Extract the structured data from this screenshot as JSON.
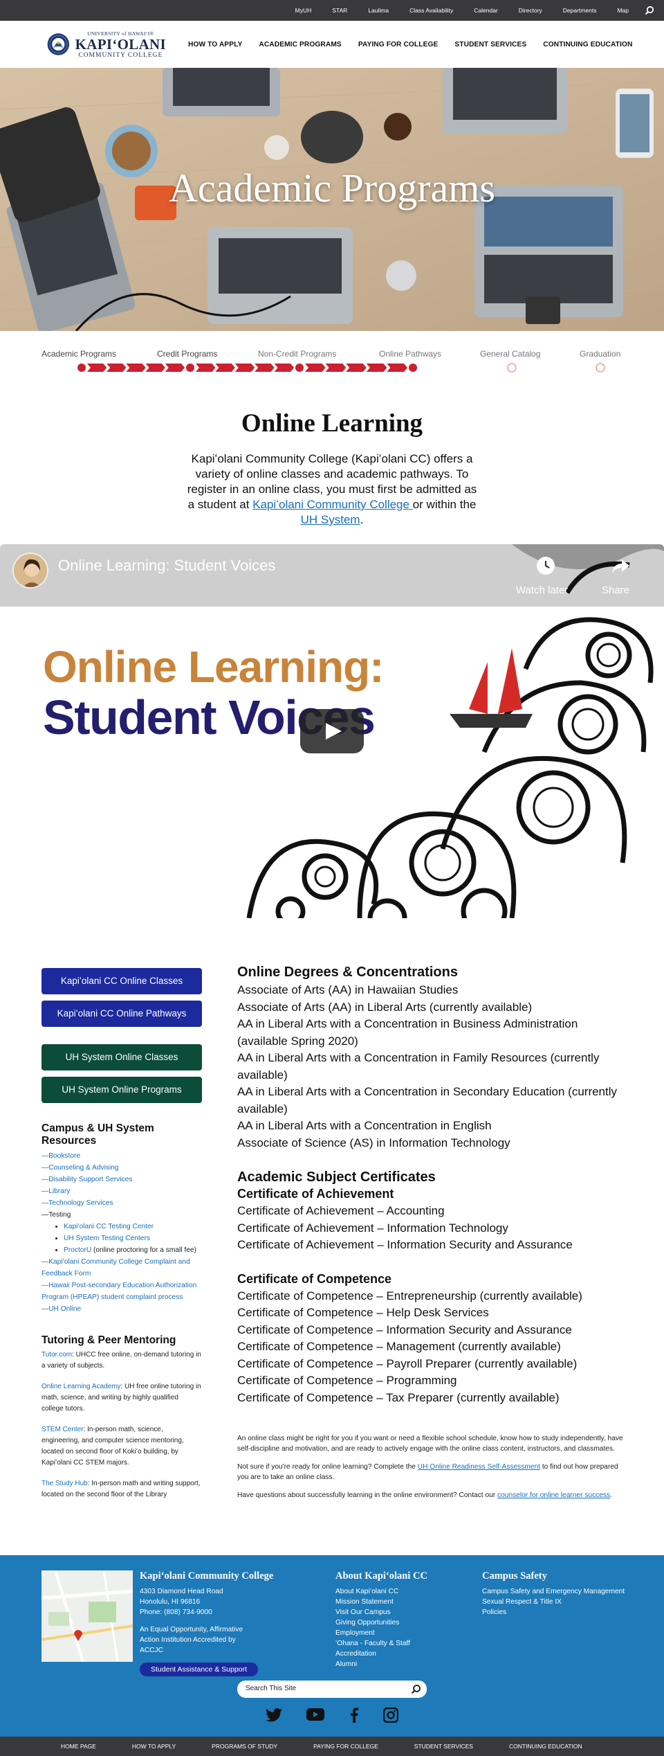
{
  "top_bar": {
    "links": [
      "MyUH",
      "STAR",
      "Laulima",
      "Class Availability",
      "Calendar",
      "Directory",
      "Departments",
      "Map"
    ],
    "search_icon": "search-icon"
  },
  "logo": {
    "university": "UNIVERSITY of HAWAIʻI®",
    "name": "KAPIʻOLANI",
    "subtitle": "COMMUNITY COLLEGE"
  },
  "main_nav": [
    "HOW TO APPLY",
    "ACADEMIC PROGRAMS",
    "PAYING FOR COLLEGE",
    "STUDENT SERVICES",
    "CONTINUING EDUCATION"
  ],
  "hero": {
    "title": "Academic Programs"
  },
  "pathway": {
    "steps": [
      "Academic Programs",
      "Credit Programs",
      "Non-Credit Programs",
      "Online Pathways",
      "General Catalog",
      "Graduation"
    ],
    "completed_steps": 4,
    "accent_color": "#cc1f2f"
  },
  "intro": {
    "title": "Online Learning",
    "text_before": "Kapiʻolani Community College (Kapiʻolani CC) offers a variety of online classes and academic pathways. To register in an online class, you must first be admitted as a student at ",
    "link1": "Kapiʻolani Community College ",
    "text_middle": "or within the ",
    "link2": "UH System",
    "text_end": "."
  },
  "video": {
    "title": "Online Learning: Student Voices",
    "watch_later": "Watch later",
    "share": "Share",
    "headline_line1": "Online Learning:",
    "headline_line2": "Student Voices"
  },
  "sidebar": {
    "buttons_blue": [
      "Kapiʻolani CC Online Classes",
      "Kapiʻolani CC Online Pathways"
    ],
    "buttons_green": [
      "UH System Online Classes",
      "UH System Online Programs"
    ],
    "resources_heading": "Campus & UH System Resources",
    "resources": [
      "—Bookstore",
      "—Counseling & Advising",
      "—Disability Support Services",
      "—Library",
      "—Technology Services"
    ],
    "testing_label": "—Testing",
    "testing_items": [
      "Kapiʻolani CC Testing Center",
      "UH System Testing Centers"
    ],
    "proctoru_link": "ProctorU",
    "proctoru_note": " (online proctoring for a small fee)",
    "resources_more": [
      "—Kapiʻolani Community College Complaint and Feedback Form",
      "—Hawaii Post-secondary Education Authorization Program (HPEAP) student complaint process",
      "—UH Online"
    ],
    "tutoring_heading": "Tutoring & Peer Mentoring",
    "tutoring": [
      {
        "link": "Tutor.com",
        "text": ": UHCC free online, on-demand tutoring in a variety of subjects."
      },
      {
        "link": "Online Learning Academy",
        "text": ": UH free online tutoring in math, science, and writing by highly qualified college tutors."
      },
      {
        "link": "STEM Center",
        "text": ": In-person math, science, engineering, and computer science mentoring, located on second floor of Kokiʻo building, by Kapiʻolani CC STEM majors."
      },
      {
        "link": "The Study Hub",
        "text": ": In-person math and writing support, located on the second floor of the Library"
      }
    ]
  },
  "content": {
    "degrees_heading": "Online Degrees & Concentrations",
    "degrees": [
      "Associate of Arts (AA) in Hawaiian Studies",
      "Associate of Arts (AA) in Liberal Arts (currently available)",
      "AA in Liberal Arts with a Concentration in Business Administration (available Spring 2020)",
      "AA in Liberal Arts with a Concentration in Family Resources (currently available)",
      "AA in Liberal Arts with a Concentration in Secondary Education (currently available)",
      "AA in Liberal Arts with a Concentration in English",
      "Associate of Science (AS) in Information Technology"
    ],
    "certs_heading": "Academic Subject Certificates",
    "achievement_heading": "Certificate of Achievement",
    "achievement": [
      "Certificate of Achievement – Accounting",
      "Certificate of Achievement – Information Technology",
      "Certificate of Achievement – Information Security and Assurance"
    ],
    "competence_heading": "Certificate of Competence",
    "competence": [
      "Certificate of Competence – Entrepreneurship (currently available)",
      "Certificate of Competence – Help Desk Services",
      "Certificate of Competence – Information Security and Assurance",
      "Certificate of Competence – Management (currently available)",
      "Certificate of Competence – Payroll Preparer (currently available)",
      "Certificate of Competence – Programming",
      "Certificate of Competence – Tax Preparer (currently available)"
    ],
    "para1": "An online class might be right for you if you want or need a flexible school schedule, know how to study independently, have self-discipline and motivation, and are ready to actively engage with the online class content, instructors, and classmates.",
    "para2_before": "Not sure if you're ready for online learning? Complete the ",
    "para2_link": "UH Online Readiness Self-Assessment",
    "para2_after": " to find out how prepared you are to take an online class.",
    "para3_before": "Have questions about successfully learning in the online environment? Contact our ",
    "para3_link": "counselor for online learner success",
    "para3_after": "."
  },
  "footer": {
    "college_name": "Kapiʻolani Community College",
    "address_lines": [
      "4303 Diamond Head Road",
      "Honolulu, HI 96816",
      "Phone: (808) 734-9000"
    ],
    "equal_opportunity": "An Equal Opportunity, Affirmative Action Institution Accredited by ACCJC",
    "assistance_button": "Student Assistance & Support",
    "about_heading": "About Kapiʻolani CC",
    "about_links": [
      "About Kapiʻolani CC",
      "Mission Statement",
      "Visit Our Campus",
      "Giving Opportunities",
      "Employment",
      "ʻOhana - Faculty & Staff",
      "Accreditation",
      "Alumni"
    ],
    "safety_heading": "Campus Safety",
    "safety_links": [
      "Campus Safety and Emergency Management",
      "Sexual Respect & Title IX",
      "Policies"
    ],
    "search_placeholder": "Search This Site",
    "social_icons": [
      "twitter-icon",
      "youtube-icon",
      "facebook-icon",
      "instagram-icon"
    ]
  },
  "bottom_nav": [
    "HOME PAGE",
    "HOW TO APPLY",
    "PROGRAMS OF STUDY",
    "PAYING FOR COLLEGE",
    "STUDENT SERVICES",
    "CONTINUING EDUCATION"
  ]
}
